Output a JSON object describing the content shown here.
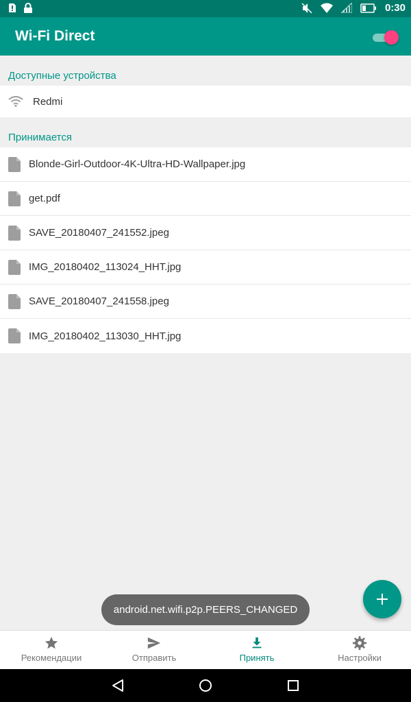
{
  "status_bar": {
    "time": "0:30",
    "icons": [
      "alert-icon",
      "lock-icon",
      "mute-icon",
      "wifi-icon",
      "signal-icon",
      "battery-icon"
    ]
  },
  "app_bar": {
    "title": "Wi-Fi Direct",
    "toggle_on": true,
    "colors": {
      "primary": "#009688",
      "status": "#00796b",
      "accent": "#ff4081"
    }
  },
  "devices": {
    "header": "Доступные устройства",
    "items": [
      {
        "label": "Redmi",
        "icon": "wifi-icon"
      }
    ]
  },
  "receiving": {
    "header": "Принимается",
    "files": [
      {
        "name": "Blonde-Girl-Outdoor-4K-Ultra-HD-Wallpaper.jpg",
        "icon": "file-icon"
      },
      {
        "name": "get.pdf",
        "icon": "file-icon"
      },
      {
        "name": "SAVE_20180407_241552.jpeg",
        "icon": "file-icon"
      },
      {
        "name": "IMG_20180402_113024_HHT.jpg",
        "icon": "file-icon"
      },
      {
        "name": "SAVE_20180407_241558.jpeg",
        "icon": "file-icon"
      },
      {
        "name": "IMG_20180402_113030_HHT.jpg",
        "icon": "file-icon"
      }
    ]
  },
  "toast": {
    "text": "android.net.wifi.p2p.PEERS_CHANGED"
  },
  "fab": {
    "icon": "plus-icon"
  },
  "bottom_nav": {
    "items": [
      {
        "label": "Рекомендации",
        "icon": "star-icon",
        "active": false
      },
      {
        "label": "Отправить",
        "icon": "send-icon",
        "active": false
      },
      {
        "label": "Принять",
        "icon": "download-icon",
        "active": true
      },
      {
        "label": "Настройки",
        "icon": "gear-icon",
        "active": false
      }
    ]
  },
  "system_nav": {
    "icons": [
      "back-icon",
      "home-icon",
      "recents-icon"
    ]
  }
}
